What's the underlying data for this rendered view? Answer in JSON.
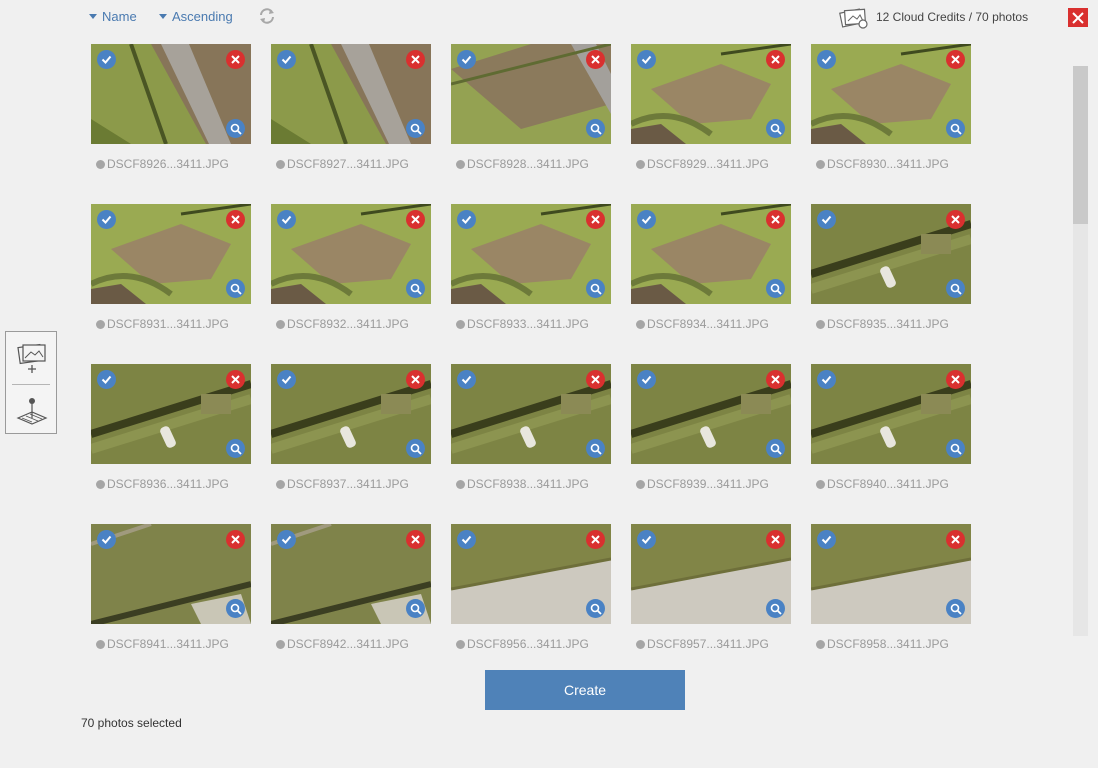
{
  "toolbar": {
    "sort_field": "Name",
    "sort_order": "Ascending",
    "credits": "12 Cloud Credits / 70 photos"
  },
  "icons": {
    "sort_caret": "caret-down-icon",
    "refresh": "refresh-icon",
    "credits": "photos-stack-icon",
    "close": "close-icon",
    "select": "check-icon",
    "remove": "remove-icon",
    "zoom": "magnifier-icon",
    "add_photos": "add-photos-icon",
    "ground_control": "ground-control-icon"
  },
  "colors": {
    "accent": "#4a82c4",
    "danger": "#d9302f",
    "button": "#4f82b8"
  },
  "photos": [
    {
      "name": "DSCF8926...3411.JPG",
      "selected": true,
      "scene": "pathL"
    },
    {
      "name": "DSCF8927...3411.JPG",
      "selected": true,
      "scene": "pathL"
    },
    {
      "name": "DSCF8928...3411.JPG",
      "selected": true,
      "scene": "pathM"
    },
    {
      "name": "DSCF8929...3411.JPG",
      "selected": true,
      "scene": "pit"
    },
    {
      "name": "DSCF8930...3411.JPG",
      "selected": true,
      "scene": "pit"
    },
    {
      "name": "DSCF8931...3411.JPG",
      "selected": true,
      "scene": "pit"
    },
    {
      "name": "DSCF8932...3411.JPG",
      "selected": true,
      "scene": "pit"
    },
    {
      "name": "DSCF8933...3411.JPG",
      "selected": true,
      "scene": "pit"
    },
    {
      "name": "DSCF8934...3411.JPG",
      "selected": true,
      "scene": "pit"
    },
    {
      "name": "DSCF8935...3411.JPG",
      "selected": true,
      "scene": "trees"
    },
    {
      "name": "DSCF8936...3411.JPG",
      "selected": true,
      "scene": "trees"
    },
    {
      "name": "DSCF8937...3411.JPG",
      "selected": true,
      "scene": "trees"
    },
    {
      "name": "DSCF8938...3411.JPG",
      "selected": true,
      "scene": "trees"
    },
    {
      "name": "DSCF8939...3411.JPG",
      "selected": true,
      "scene": "trees"
    },
    {
      "name": "DSCF8940...3411.JPG",
      "selected": true,
      "scene": "trees"
    },
    {
      "name": "DSCF8941...3411.JPG",
      "selected": true,
      "scene": "field"
    },
    {
      "name": "DSCF8942...3411.JPG",
      "selected": true,
      "scene": "field"
    },
    {
      "name": "DSCF8956...3411.JPG",
      "selected": true,
      "scene": "road"
    },
    {
      "name": "DSCF8957...3411.JPG",
      "selected": true,
      "scene": "road"
    },
    {
      "name": "DSCF8958...3411.JPG",
      "selected": true,
      "scene": "road"
    }
  ],
  "actions": {
    "create": "Create"
  },
  "status": {
    "selected": "70 photos selected"
  }
}
